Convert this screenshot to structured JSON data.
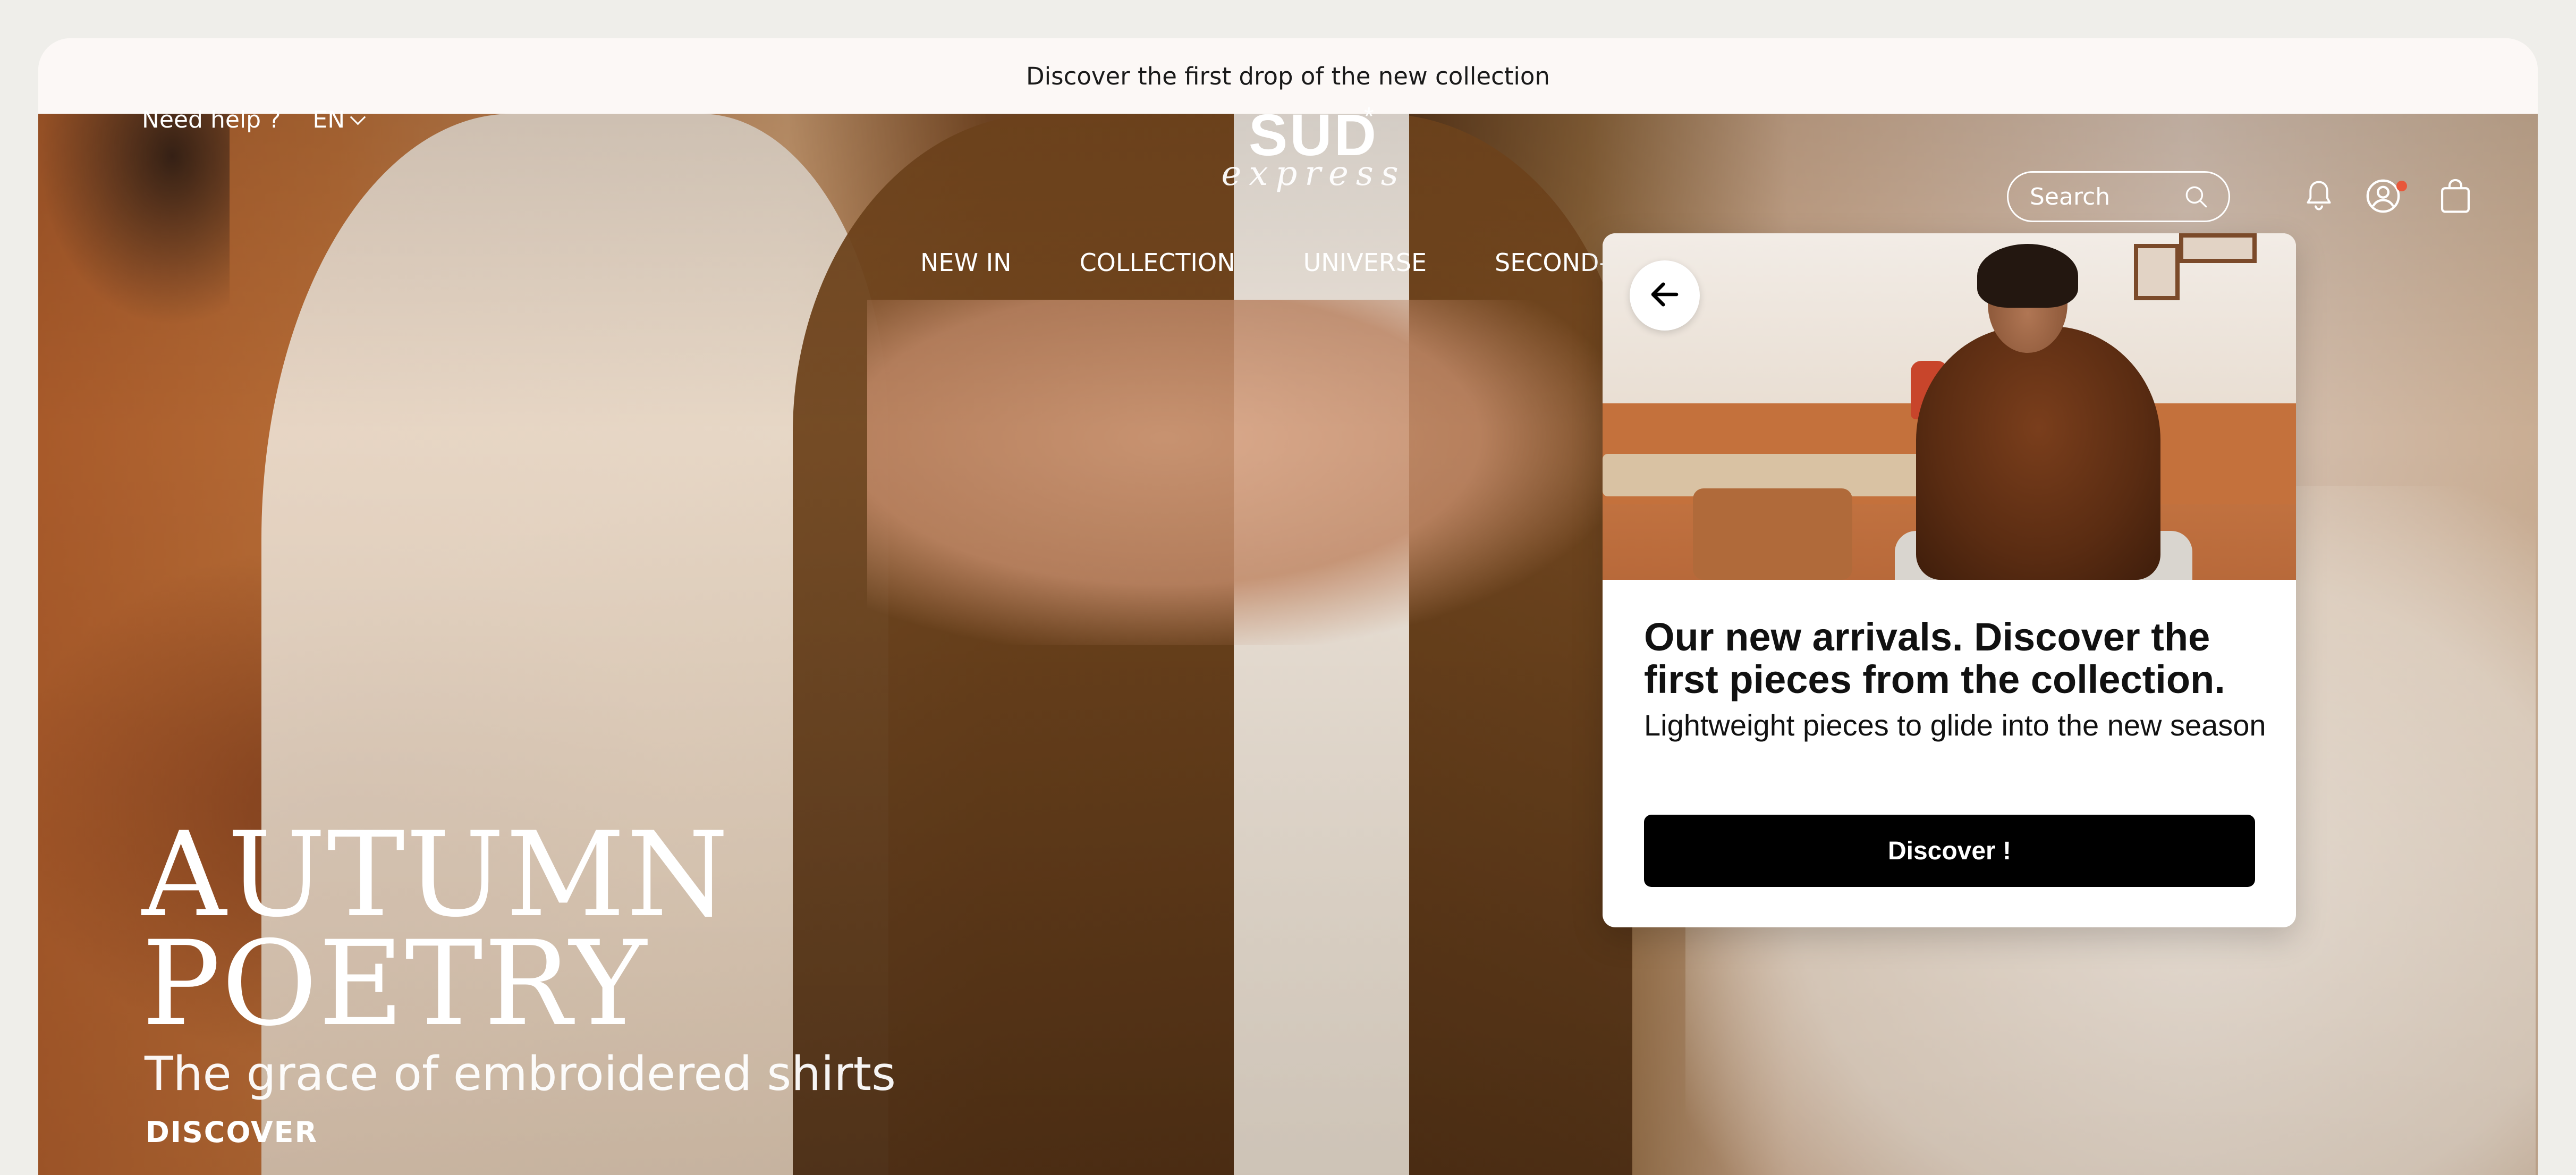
{
  "announcement": {
    "text": "Discover the first drop of the new collection"
  },
  "header": {
    "help_label": "Need help ?",
    "language": "EN",
    "logo": {
      "main": "SUD",
      "star": "*",
      "script": "express"
    },
    "nav": [
      "NEW IN",
      "COLLECTION",
      "UNIVERSE",
      "SECOND-H"
    ],
    "search": {
      "placeholder": "Search"
    },
    "icons": [
      "search-icon",
      "bell-icon",
      "account-icon",
      "bag-icon"
    ],
    "notification_dot_color": "#e8573a"
  },
  "hero": {
    "title_line1": "AUTUMN",
    "title_line2": "POETRY",
    "subtitle": "The grace of embroidered shirts",
    "cta": "DISCOVER"
  },
  "popup": {
    "back_icon": "arrow-left-icon",
    "title": "Our new arrivals. Discover the first pieces from the collection.",
    "subtitle": "Lightweight pieces to glide into the new season",
    "button": "Discover !"
  },
  "colors": {
    "button_bg": "#000000",
    "hero_tone": "#a85a2a",
    "card_bg": "#ffffff"
  }
}
